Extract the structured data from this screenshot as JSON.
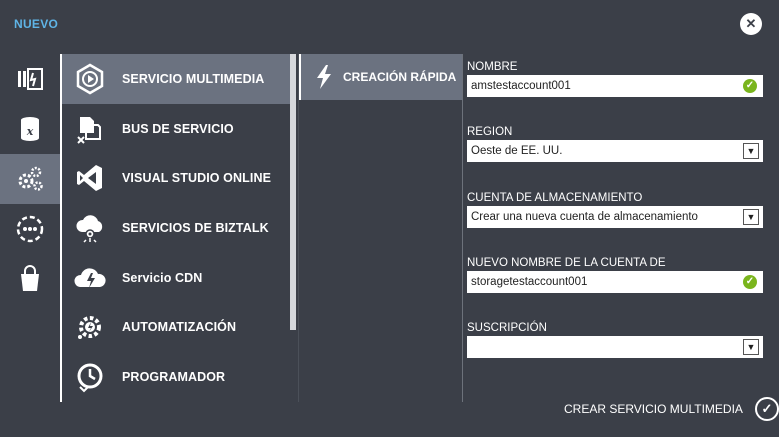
{
  "dialog": {
    "title": "NUEVO",
    "close_icon": "close-icon"
  },
  "rail": {
    "items": [
      {
        "icon": "web-sites-icon",
        "active": false
      },
      {
        "icon": "sql-database-icon",
        "active": false
      },
      {
        "icon": "app-services-icon",
        "active": true
      },
      {
        "icon": "network-services-icon",
        "active": false
      },
      {
        "icon": "store-bag-icon",
        "active": false
      }
    ]
  },
  "categories": {
    "items": [
      {
        "label": "SERVICIO MULTIMEDIA",
        "icon": "media-services-icon",
        "active": true
      },
      {
        "label": "BUS DE SERVICIO",
        "icon": "service-bus-icon",
        "active": false
      },
      {
        "label": "VISUAL STUDIO ONLINE",
        "icon": "visual-studio-icon",
        "active": false
      },
      {
        "label": "SERVICIOS DE BIZTALK",
        "icon": "biztalk-cloud-icon",
        "active": false
      },
      {
        "label": "Servicio CDN",
        "icon": "cdn-cloud-icon",
        "active": false
      },
      {
        "label": "AUTOMATIZACIÓN",
        "icon": "automation-gear-icon",
        "active": false
      },
      {
        "label": "PROGRAMADOR",
        "icon": "scheduler-clock-icon",
        "active": false
      }
    ]
  },
  "methods": {
    "quick_create": "CREACIÓN RÁPIDA",
    "icon": "lightning-icon"
  },
  "form": {
    "name_label": "NOMBRE",
    "name_value": "amstestaccount001",
    "region_label": "REGION",
    "region_value": "Oeste de EE. UU.",
    "storage_label": "CUENTA DE ALMACENAMIENTO",
    "storage_value": "Crear una nueva cuenta de almacenamiento",
    "new_storage_label": "NUEVO NOMBRE DE LA CUENTA DE ALMACENAMIENTO",
    "new_storage_value": "storagetestaccount001",
    "subscription_label": "SUSCRIPCIÓN",
    "subscription_value": ""
  },
  "submit": {
    "label": "CREAR SERVICIO MULTIMEDIA",
    "icon": "checkmark-icon"
  },
  "colors": {
    "background": "#3b3f48",
    "selected": "#6b7280",
    "title_accent": "#5fb4e6",
    "valid": "#7ab51d"
  }
}
